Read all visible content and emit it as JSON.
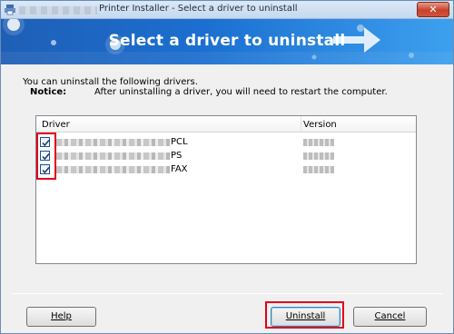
{
  "window": {
    "title": "Printer Installer - Select a driver to uninstall",
    "close_glyph": "✕"
  },
  "banner": {
    "title": "Select a driver to uninstall"
  },
  "intro": {
    "text": "You can uninstall the following drivers.",
    "notice_label": "Notice:",
    "notice_text": "After uninstalling a driver, you will need to restart the computer."
  },
  "list": {
    "columns": {
      "driver": "Driver",
      "version": "Version"
    },
    "rows": [
      {
        "suffix": "PCL",
        "checked": true
      },
      {
        "suffix": "PS",
        "checked": true
      },
      {
        "suffix": "FAX",
        "checked": true
      }
    ]
  },
  "buttons": {
    "help": "Help",
    "uninstall": "Uninstall",
    "cancel": "Cancel"
  },
  "colors": {
    "highlight": "#e0001a",
    "banner_start": "#1f5fb6",
    "banner_end": "#3da0ee"
  }
}
